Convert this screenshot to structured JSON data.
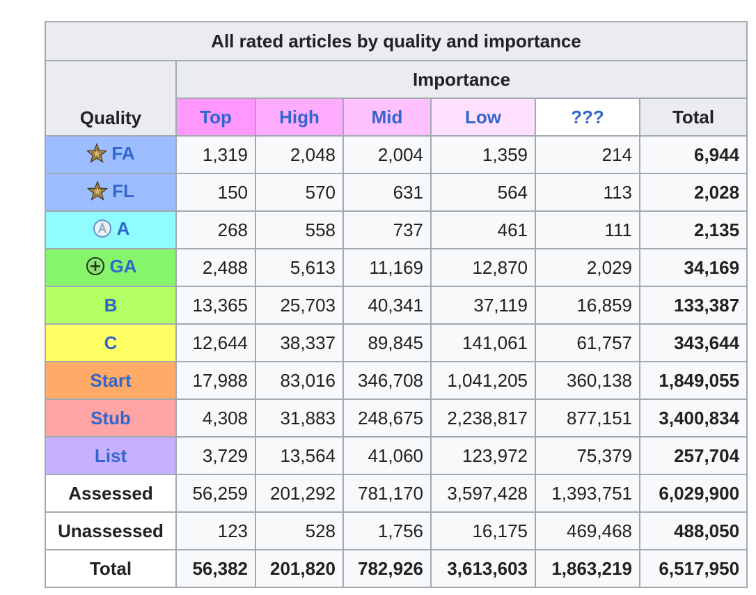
{
  "table": {
    "caption": "All rated articles by quality and importance",
    "importance_label": "Importance",
    "quality_label": "Quality",
    "columns": [
      {
        "label": "Top",
        "bg": "#ff97ff"
      },
      {
        "label": "High",
        "bg": "#ffacff"
      },
      {
        "label": "Mid",
        "bg": "#ffc1ff"
      },
      {
        "label": "Low",
        "bg": "#ffe0ff"
      },
      {
        "label": "???",
        "bg": "#ffffff"
      }
    ],
    "total_label": "Total",
    "rows": [
      {
        "label": "FA",
        "icon": "featured-star-icon",
        "bg": "#9cbdff",
        "values": [
          "1,319",
          "2,048",
          "2,004",
          "1,359",
          "214"
        ],
        "total": "6,944"
      },
      {
        "label": "FL",
        "icon": "featured-star-icon",
        "bg": "#9cbdff",
        "values": [
          "150",
          "570",
          "631",
          "564",
          "113"
        ],
        "total": "2,028"
      },
      {
        "label": "A",
        "icon": "a-class-circle-icon",
        "bg": "#8ffcff",
        "values": [
          "268",
          "558",
          "737",
          "461",
          "111"
        ],
        "total": "2,135"
      },
      {
        "label": "GA",
        "icon": "good-article-plus-icon",
        "bg": "#86f56b",
        "values": [
          "2,488",
          "5,613",
          "11,169",
          "12,870",
          "2,029"
        ],
        "total": "34,169"
      },
      {
        "label": "B",
        "icon": "",
        "bg": "#b2ff66",
        "values": [
          "13,365",
          "25,703",
          "40,341",
          "37,119",
          "16,859"
        ],
        "total": "133,387"
      },
      {
        "label": "C",
        "icon": "",
        "bg": "#ffff66",
        "values": [
          "12,644",
          "38,337",
          "89,845",
          "141,061",
          "61,757"
        ],
        "total": "343,644"
      },
      {
        "label": "Start",
        "icon": "",
        "bg": "#ffaa66",
        "values": [
          "17,988",
          "83,016",
          "346,708",
          "1,041,205",
          "360,138"
        ],
        "total": "1,849,055"
      },
      {
        "label": "Stub",
        "icon": "",
        "bg": "#ffa4a4",
        "values": [
          "4,308",
          "31,883",
          "248,675",
          "2,238,817",
          "877,151"
        ],
        "total": "3,400,834"
      },
      {
        "label": "List",
        "icon": "",
        "bg": "#c7b1ff",
        "values": [
          "3,729",
          "13,564",
          "41,060",
          "123,972",
          "75,379"
        ],
        "total": "257,704"
      },
      {
        "label": "Assessed",
        "icon": "",
        "bg": "#ffffff",
        "plain": true,
        "values": [
          "56,259",
          "201,292",
          "781,170",
          "3,597,428",
          "1,393,751"
        ],
        "total": "6,029,900"
      },
      {
        "label": "Unassessed",
        "icon": "",
        "bg": "#ffffff",
        "plain": true,
        "values": [
          "123",
          "528",
          "1,756",
          "16,175",
          "469,468"
        ],
        "total": "488,050"
      }
    ],
    "total_row": {
      "label": "Total",
      "values": [
        "56,382",
        "201,820",
        "782,926",
        "3,613,603",
        "1,863,219"
      ],
      "total": "6,517,950"
    }
  }
}
